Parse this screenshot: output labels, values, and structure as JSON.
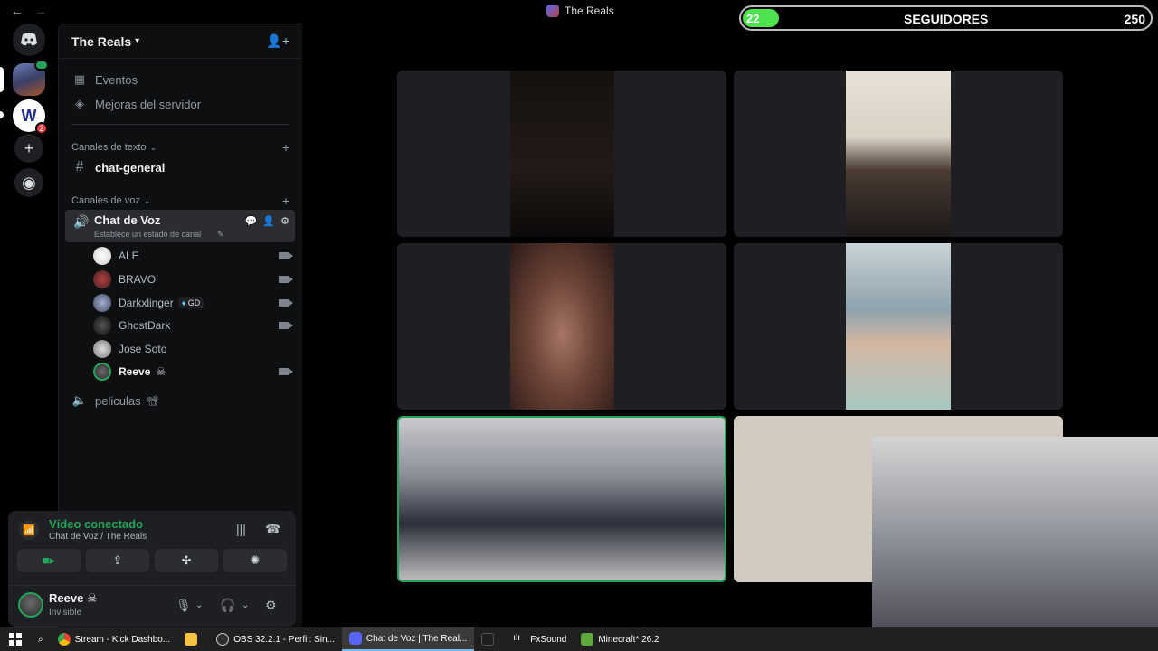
{
  "window": {
    "title": "The Reals",
    "back_icon": "←",
    "forward_icon": "→"
  },
  "followers": {
    "current": "22",
    "label": "SEGUIDORES",
    "goal": "250",
    "progress_fraction": 0.088,
    "bar_color": "#4ee34e"
  },
  "server": {
    "name": "The Reals",
    "items": [
      {
        "label": "Eventos",
        "icon": "calendar-icon"
      },
      {
        "label": "Mejoras del servidor",
        "icon": "boost-icon"
      }
    ],
    "text_category": "Canales de texto",
    "text_channels": [
      {
        "label": "chat-general"
      }
    ],
    "voice_category": "Canales de voz",
    "voice_channel": {
      "name": "Chat de Voz",
      "status": "Establece un estado de canal"
    },
    "members": [
      {
        "name": "ALE",
        "camera": true
      },
      {
        "name": "BRAVO",
        "camera": true
      },
      {
        "name": "Darkxlinger",
        "badge": "GD",
        "camera": true
      },
      {
        "name": "GhostDark",
        "camera": true
      },
      {
        "name": "Jose Soto",
        "camera": false
      },
      {
        "name": "Reeve",
        "emoji": "☠",
        "camera": true
      }
    ],
    "other_voice_channel": {
      "name": "peliculas",
      "emoji": "📽"
    }
  },
  "voice_panel": {
    "title": "Vídeo conectado",
    "subtitle": "Chat de Voz / The Reals",
    "accent": "#23a55a"
  },
  "user": {
    "name": "Reeve",
    "emoji": "☠",
    "status": "Invisible"
  },
  "taskbar": {
    "items": [
      {
        "label": "Stream - Kick Dashbo...",
        "icon": "chrome-icon"
      },
      {
        "label": "",
        "icon": "folder-icon"
      },
      {
        "label": "OBS 32.2.1 - Perfil: Sin...",
        "icon": "obs-icon"
      },
      {
        "label": "Chat de Voz | The Real...",
        "icon": "discord-icon"
      },
      {
        "label": "",
        "icon": "terminal-icon"
      },
      {
        "label": "FxSound",
        "icon": "fxsound-icon"
      },
      {
        "label": "Minecraft* 26.2",
        "icon": "minecraft-icon"
      }
    ]
  }
}
